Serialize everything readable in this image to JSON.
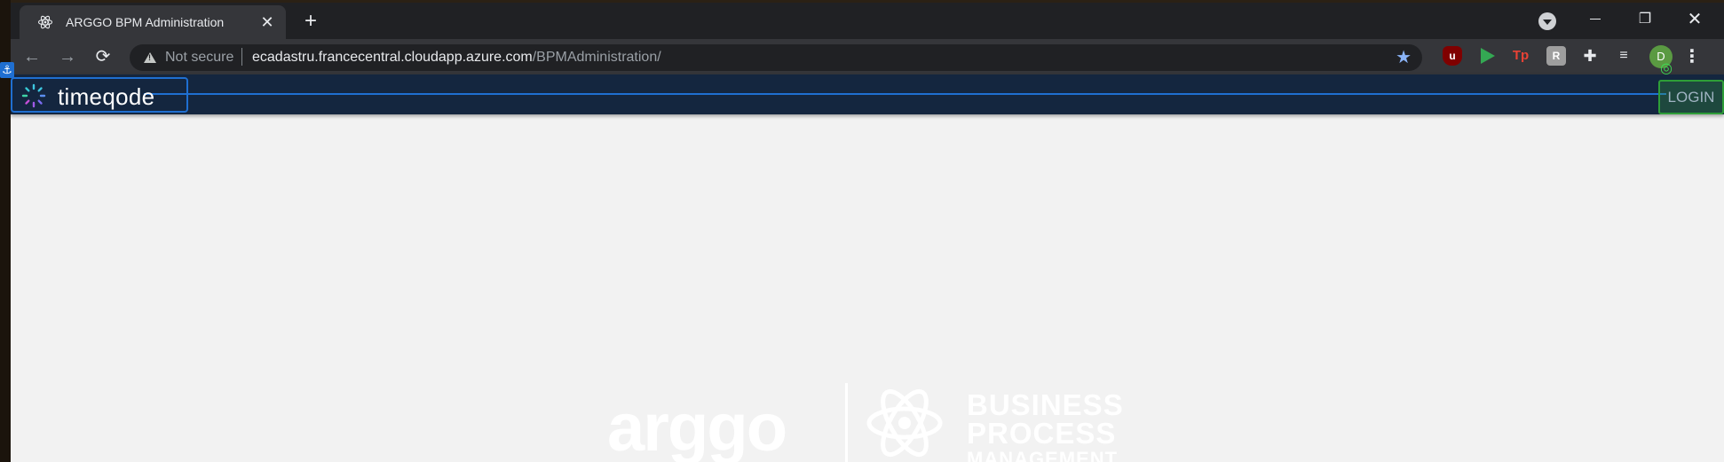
{
  "browser": {
    "tab": {
      "title": "ARGGO BPM Administration",
      "favicon": "atom-icon",
      "close": "✕"
    },
    "new_tab": "+",
    "window": {
      "minimize": "minimize-icon",
      "maximize": "❐",
      "close": "✕"
    },
    "toolbar": {
      "back": "←",
      "forward": "→",
      "reload": "⟳",
      "security_label": "Not secure",
      "url_host": "ecadastru.francecentral.cloudapp.azure.com",
      "url_path": "/BPMAdministration/",
      "bookmark": "★",
      "extensions": [
        {
          "name": "ublock-origin-icon",
          "glyph": "u"
        },
        {
          "name": "play-icon",
          "glyph": ""
        },
        {
          "name": "tp-extension-icon",
          "glyph": "Tp"
        },
        {
          "name": "r-extension-icon",
          "glyph": "R"
        },
        {
          "name": "puzzle-icon",
          "glyph": "✚"
        },
        {
          "name": "media-control-icon",
          "glyph": "≡"
        }
      ],
      "profile_initial": "D",
      "menu": "⋮"
    }
  },
  "app": {
    "logo_text": "timeqode",
    "login_label": "LOGIN",
    "colors": {
      "header_bg": "#14263f",
      "accent": "#1f6fd1",
      "page_bg": "#f2f2f2"
    }
  },
  "watermark": {
    "brand": "arggo",
    "line1": "BUSINESS",
    "line2": "PROCESS",
    "line3": "MANAGEMENT"
  }
}
